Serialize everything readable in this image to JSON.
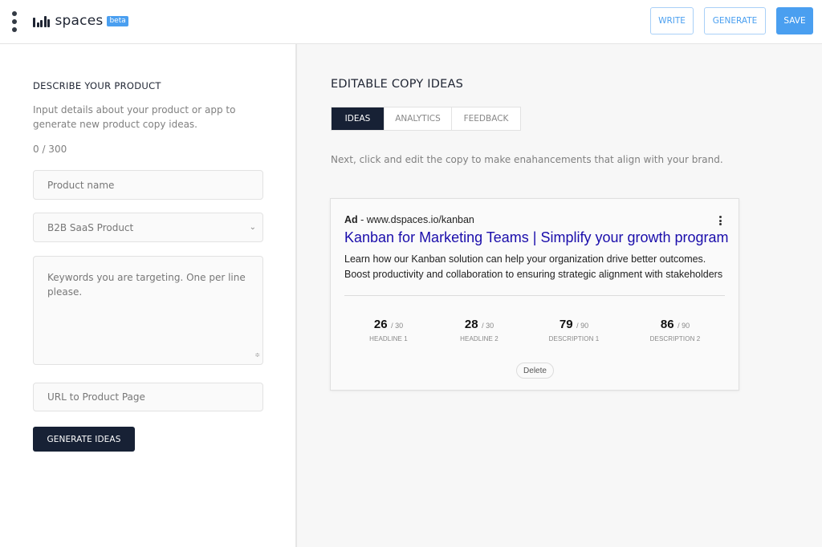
{
  "header": {
    "app_name": "spaces",
    "badge": "beta",
    "buttons": {
      "write": "WRITE",
      "generate": "GENERATE",
      "save": "SAVE"
    },
    "accent_color": "#4a9ff0"
  },
  "left_panel": {
    "title": "DESCRIBE YOUR PRODUCT",
    "description": "Input details about your product or app to generate new product copy ideas.",
    "char_counter": "0 / 300",
    "product_name_placeholder": "Product name",
    "product_type_selected": "B2B SaaS Product",
    "keywords_placeholder": "Keywords you are targeting. One per line please.",
    "url_placeholder": "URL to Product Page",
    "generate_button": "GENERATE IDEAS"
  },
  "right_panel": {
    "title": "EDITABLE COPY IDEAS",
    "tabs": [
      {
        "label": "IDEAS",
        "active": true
      },
      {
        "label": "ANALYTICS",
        "active": false
      },
      {
        "label": "FEEDBACK",
        "active": false
      }
    ],
    "hint": "Next, click and edit the copy to make enahancements that align with your brand.",
    "ad_card": {
      "ad_label": "Ad",
      "separator": " - ",
      "display_url": "www.dspaces.io/kanban",
      "headline": "Kanban for Marketing Teams | Simplify your growth program",
      "description": "Learn how our Kanban solution can help your organization drive better outcomes. Boost productivity and collaboration to ensuring strategic alignment with stakeholders",
      "stats": [
        {
          "value": "26",
          "max": "/ 30",
          "label": "HEADLINE 1"
        },
        {
          "value": "28",
          "max": "/ 30",
          "label": "HEADLINE 2"
        },
        {
          "value": "79",
          "max": "/ 90",
          "label": "DESCRIPTION 1"
        },
        {
          "value": "86",
          "max": "/ 90",
          "label": "DESCRIPTION 2"
        }
      ],
      "delete_button": "Delete"
    }
  }
}
